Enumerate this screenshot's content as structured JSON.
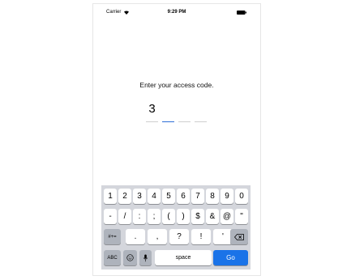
{
  "status_bar": {
    "carrier": "Carrier",
    "time": "9:29 PM"
  },
  "prompt": "Enter your access code.",
  "code": {
    "digits": [
      "3",
      "",
      "",
      ""
    ],
    "active_index": 1
  },
  "keyboard": {
    "row1": [
      "1",
      "2",
      "3",
      "4",
      "5",
      "6",
      "7",
      "8",
      "9",
      "0"
    ],
    "row2": [
      "-",
      "/",
      ":",
      ";",
      "(",
      ")",
      "$",
      "&",
      "@",
      "\""
    ],
    "row3": {
      "toggle": "#+=",
      "keys": [
        ".",
        ",",
        "?",
        "!",
        "'"
      ],
      "delete_icon": "backspace-icon"
    },
    "row4": {
      "abc": "ABC",
      "emoji_icon": "emoji-icon",
      "mic_icon": "microphone-icon",
      "space": "space",
      "go": "Go"
    }
  },
  "colors": {
    "accent": "#1a73e8",
    "active_underline": "#2f6fd6",
    "keyboard_bg": "#d4d6dc",
    "dark_key": "#aeb3bc"
  }
}
